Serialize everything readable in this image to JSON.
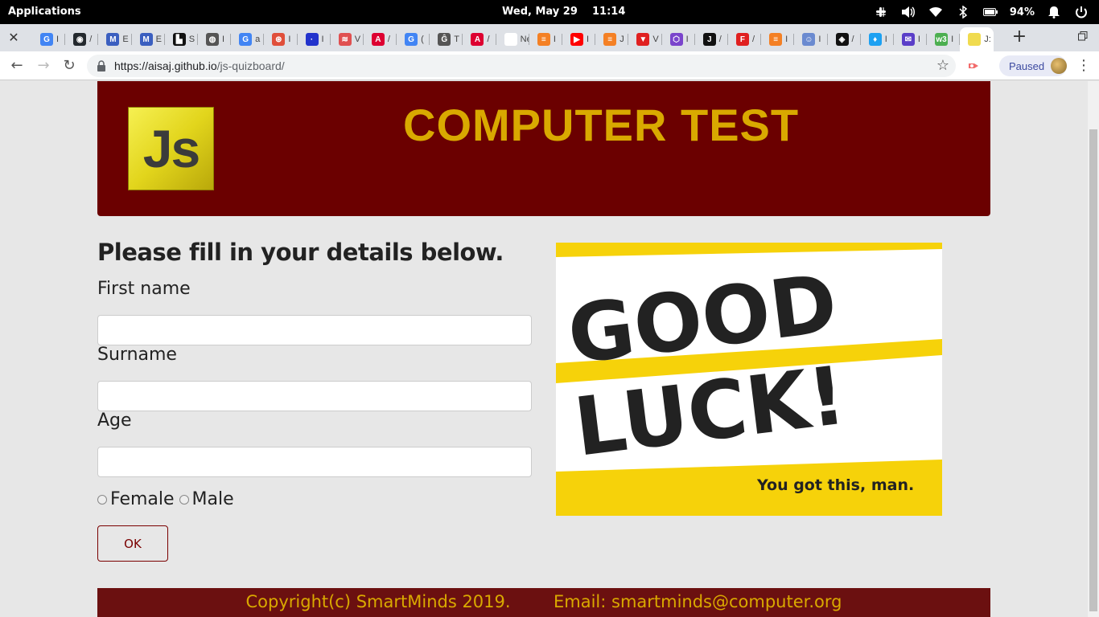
{
  "system_bar": {
    "apps_label": "Applications",
    "date": "Wed, May 29",
    "time": "11:14",
    "battery": "94%"
  },
  "browser": {
    "tabs": [
      {
        "icon": "google-icon",
        "color": "#4285f4",
        "glyph": "G",
        "title": "I"
      },
      {
        "icon": "github-icon",
        "color": "#24292e",
        "glyph": "◉",
        "title": "/"
      },
      {
        "icon": "mdb-icon",
        "color": "#3b5fc0",
        "glyph": "M",
        "title": "E"
      },
      {
        "icon": "mdb-icon",
        "color": "#3b5fc0",
        "glyph": "M",
        "title": "E"
      },
      {
        "icon": "bank-icon",
        "color": "#111111",
        "glyph": "▙",
        "title": "S"
      },
      {
        "icon": "globe-icon",
        "color": "#555555",
        "glyph": "◍",
        "title": "I"
      },
      {
        "icon": "google-icon",
        "color": "#4285f4",
        "glyph": "G",
        "title": "a"
      },
      {
        "icon": "openai-icon",
        "color": "#e04f3a",
        "glyph": "⊛",
        "title": "I"
      },
      {
        "icon": "dot-icon",
        "color": "#2233cc",
        "glyph": "·",
        "title": "I"
      },
      {
        "icon": "stripes-icon",
        "color": "#e05050",
        "glyph": "≋",
        "title": "V"
      },
      {
        "icon": "angular-icon",
        "color": "#dd0031",
        "glyph": "A",
        "title": "/"
      },
      {
        "icon": "google-icon",
        "color": "#4285f4",
        "glyph": "G",
        "title": "("
      },
      {
        "icon": "glitch-icon",
        "color": "#555555",
        "glyph": "Ĝ",
        "title": "T"
      },
      {
        "icon": "angular-icon",
        "color": "#dd0031",
        "glyph": "A",
        "title": "/"
      },
      {
        "icon": "new-tab-icon",
        "color": "#ffffff",
        "glyph": "",
        "title": "New"
      },
      {
        "icon": "stackoverflow-icon",
        "color": "#f48024",
        "glyph": "≡",
        "title": "I"
      },
      {
        "icon": "youtube-icon",
        "color": "#ff0000",
        "glyph": "▶",
        "title": "I"
      },
      {
        "icon": "stackoverflow-icon",
        "color": "#f48024",
        "glyph": "≡",
        "title": "J"
      },
      {
        "icon": "flag-icon",
        "color": "#e02020",
        "glyph": "▼",
        "title": "V"
      },
      {
        "icon": "hexagon-icon",
        "color": "#7a44cc",
        "glyph": "⬡",
        "title": "I"
      },
      {
        "icon": "j-icon",
        "color": "#111111",
        "glyph": "J",
        "title": "/"
      },
      {
        "icon": "f-icon",
        "color": "#e02020",
        "glyph": "F",
        "title": "/"
      },
      {
        "icon": "stackoverflow-icon",
        "color": "#f48024",
        "glyph": "≡",
        "title": "I"
      },
      {
        "icon": "cat-icon",
        "color": "#6a8ad0",
        "glyph": "☺",
        "title": "I"
      },
      {
        "icon": "codepen-icon",
        "color": "#111111",
        "glyph": "◈",
        "title": "/"
      },
      {
        "icon": "bird-icon",
        "color": "#1da1f2",
        "glyph": "♦",
        "title": "I"
      },
      {
        "icon": "chat-icon",
        "color": "#5a3ec8",
        "glyph": "✉",
        "title": "I"
      },
      {
        "icon": "w3-icon",
        "color": "#4caf50",
        "glyph": "w3",
        "title": "I"
      },
      {
        "icon": "js-icon",
        "color": "#f0db4f",
        "glyph": "",
        "title": "J:"
      }
    ],
    "url_host": "https://aisaj.github.io",
    "url_path": "/js-quizboard/",
    "profile_label": "Paused"
  },
  "page": {
    "logo_text": "Js",
    "title": "COMPUTER TEST",
    "form_heading": "Please fill in your details below.",
    "first_name_label": "First name",
    "surname_label": "Surname",
    "age_label": "Age",
    "first_name_value": "",
    "surname_value": "",
    "age_value": "",
    "gender_female": "Female",
    "gender_male": "Male",
    "ok_label": "OK",
    "image": {
      "line1": "GOOD",
      "line2": "LUCK!",
      "tagline": "You got this, man."
    },
    "footer_copyright": "Copyright(c) SmartMinds 2019.",
    "footer_email": "Email: smartminds@computer.org"
  }
}
